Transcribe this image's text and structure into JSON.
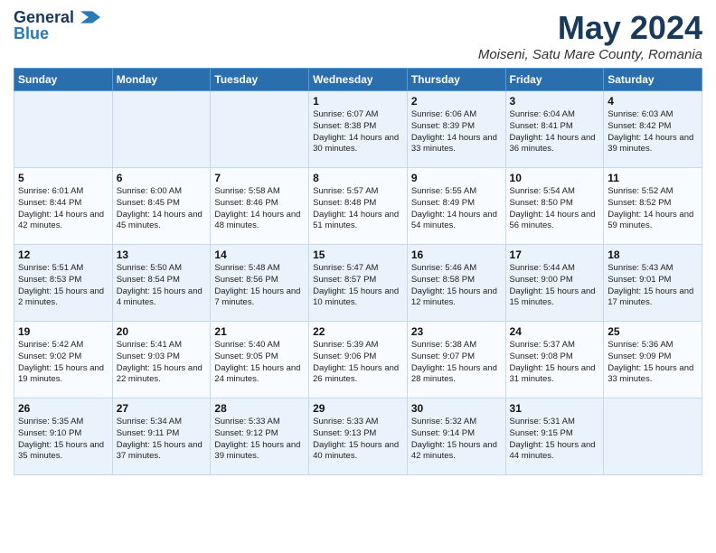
{
  "header": {
    "logo_line1": "General",
    "logo_line2": "Blue",
    "month_year": "May 2024",
    "location": "Moiseni, Satu Mare County, Romania"
  },
  "days_of_week": [
    "Sunday",
    "Monday",
    "Tuesday",
    "Wednesday",
    "Thursday",
    "Friday",
    "Saturday"
  ],
  "weeks": [
    [
      {
        "day": "",
        "info": ""
      },
      {
        "day": "",
        "info": ""
      },
      {
        "day": "",
        "info": ""
      },
      {
        "day": "1",
        "info": "Sunrise: 6:07 AM\nSunset: 8:38 PM\nDaylight: 14 hours\nand 30 minutes."
      },
      {
        "day": "2",
        "info": "Sunrise: 6:06 AM\nSunset: 8:39 PM\nDaylight: 14 hours\nand 33 minutes."
      },
      {
        "day": "3",
        "info": "Sunrise: 6:04 AM\nSunset: 8:41 PM\nDaylight: 14 hours\nand 36 minutes."
      },
      {
        "day": "4",
        "info": "Sunrise: 6:03 AM\nSunset: 8:42 PM\nDaylight: 14 hours\nand 39 minutes."
      }
    ],
    [
      {
        "day": "5",
        "info": "Sunrise: 6:01 AM\nSunset: 8:44 PM\nDaylight: 14 hours\nand 42 minutes."
      },
      {
        "day": "6",
        "info": "Sunrise: 6:00 AM\nSunset: 8:45 PM\nDaylight: 14 hours\nand 45 minutes."
      },
      {
        "day": "7",
        "info": "Sunrise: 5:58 AM\nSunset: 8:46 PM\nDaylight: 14 hours\nand 48 minutes."
      },
      {
        "day": "8",
        "info": "Sunrise: 5:57 AM\nSunset: 8:48 PM\nDaylight: 14 hours\nand 51 minutes."
      },
      {
        "day": "9",
        "info": "Sunrise: 5:55 AM\nSunset: 8:49 PM\nDaylight: 14 hours\nand 54 minutes."
      },
      {
        "day": "10",
        "info": "Sunrise: 5:54 AM\nSunset: 8:50 PM\nDaylight: 14 hours\nand 56 minutes."
      },
      {
        "day": "11",
        "info": "Sunrise: 5:52 AM\nSunset: 8:52 PM\nDaylight: 14 hours\nand 59 minutes."
      }
    ],
    [
      {
        "day": "12",
        "info": "Sunrise: 5:51 AM\nSunset: 8:53 PM\nDaylight: 15 hours\nand 2 minutes."
      },
      {
        "day": "13",
        "info": "Sunrise: 5:50 AM\nSunset: 8:54 PM\nDaylight: 15 hours\nand 4 minutes."
      },
      {
        "day": "14",
        "info": "Sunrise: 5:48 AM\nSunset: 8:56 PM\nDaylight: 15 hours\nand 7 minutes."
      },
      {
        "day": "15",
        "info": "Sunrise: 5:47 AM\nSunset: 8:57 PM\nDaylight: 15 hours\nand 10 minutes."
      },
      {
        "day": "16",
        "info": "Sunrise: 5:46 AM\nSunset: 8:58 PM\nDaylight: 15 hours\nand 12 minutes."
      },
      {
        "day": "17",
        "info": "Sunrise: 5:44 AM\nSunset: 9:00 PM\nDaylight: 15 hours\nand 15 minutes."
      },
      {
        "day": "18",
        "info": "Sunrise: 5:43 AM\nSunset: 9:01 PM\nDaylight: 15 hours\nand 17 minutes."
      }
    ],
    [
      {
        "day": "19",
        "info": "Sunrise: 5:42 AM\nSunset: 9:02 PM\nDaylight: 15 hours\nand 19 minutes."
      },
      {
        "day": "20",
        "info": "Sunrise: 5:41 AM\nSunset: 9:03 PM\nDaylight: 15 hours\nand 22 minutes."
      },
      {
        "day": "21",
        "info": "Sunrise: 5:40 AM\nSunset: 9:05 PM\nDaylight: 15 hours\nand 24 minutes."
      },
      {
        "day": "22",
        "info": "Sunrise: 5:39 AM\nSunset: 9:06 PM\nDaylight: 15 hours\nand 26 minutes."
      },
      {
        "day": "23",
        "info": "Sunrise: 5:38 AM\nSunset: 9:07 PM\nDaylight: 15 hours\nand 28 minutes."
      },
      {
        "day": "24",
        "info": "Sunrise: 5:37 AM\nSunset: 9:08 PM\nDaylight: 15 hours\nand 31 minutes."
      },
      {
        "day": "25",
        "info": "Sunrise: 5:36 AM\nSunset: 9:09 PM\nDaylight: 15 hours\nand 33 minutes."
      }
    ],
    [
      {
        "day": "26",
        "info": "Sunrise: 5:35 AM\nSunset: 9:10 PM\nDaylight: 15 hours\nand 35 minutes."
      },
      {
        "day": "27",
        "info": "Sunrise: 5:34 AM\nSunset: 9:11 PM\nDaylight: 15 hours\nand 37 minutes."
      },
      {
        "day": "28",
        "info": "Sunrise: 5:33 AM\nSunset: 9:12 PM\nDaylight: 15 hours\nand 39 minutes."
      },
      {
        "day": "29",
        "info": "Sunrise: 5:33 AM\nSunset: 9:13 PM\nDaylight: 15 hours\nand 40 minutes."
      },
      {
        "day": "30",
        "info": "Sunrise: 5:32 AM\nSunset: 9:14 PM\nDaylight: 15 hours\nand 42 minutes."
      },
      {
        "day": "31",
        "info": "Sunrise: 5:31 AM\nSunset: 9:15 PM\nDaylight: 15 hours\nand 44 minutes."
      },
      {
        "day": "",
        "info": ""
      }
    ]
  ]
}
